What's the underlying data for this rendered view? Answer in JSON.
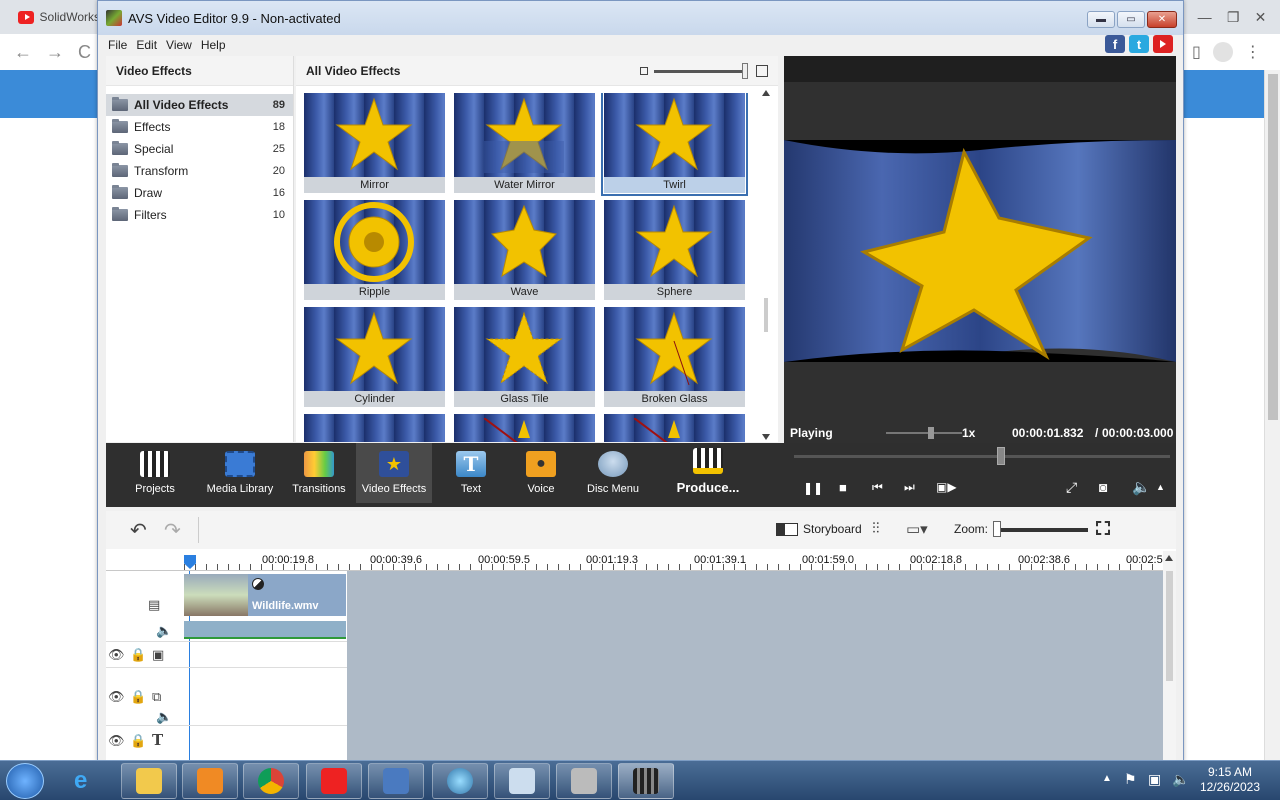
{
  "browser": {
    "tab_title": "SolidWorks"
  },
  "app": {
    "title": "AVS Video Editor 9.9 - Non-activated",
    "menu": [
      "File",
      "Edit",
      "View",
      "Help"
    ],
    "social": {
      "facebook": "f",
      "twitter": "t"
    }
  },
  "categories_panel": {
    "title": "Video Effects",
    "items": [
      {
        "label": "All Video Effects",
        "count": "89",
        "selected": true
      },
      {
        "label": "Effects",
        "count": "18"
      },
      {
        "label": "Special",
        "count": "25"
      },
      {
        "label": "Transform",
        "count": "20"
      },
      {
        "label": "Draw",
        "count": "16"
      },
      {
        "label": "Filters",
        "count": "10"
      }
    ]
  },
  "effects_panel": {
    "title": "All Video Effects",
    "tiles": [
      {
        "label": "Mirror"
      },
      {
        "label": "Water Mirror"
      },
      {
        "label": "Twirl",
        "selected": true
      },
      {
        "label": "Ripple"
      },
      {
        "label": "Wave"
      },
      {
        "label": "Sphere"
      },
      {
        "label": "Cylinder"
      },
      {
        "label": "Glass Tile"
      },
      {
        "label": "Broken Glass"
      }
    ]
  },
  "preview": {
    "status": "Playing",
    "speed": "1x",
    "current_time": "00:00:01.832",
    "separator": "/",
    "total_time": "00:00:03.000",
    "seek_fraction": 0.55
  },
  "modules": [
    {
      "label": "Projects",
      "icon": "clapper-icon"
    },
    {
      "label": "Media Library",
      "icon": "film-icon"
    },
    {
      "label": "Transitions",
      "icon": "transitions-icon"
    },
    {
      "label": "Video Effects",
      "icon": "star-icon",
      "selected": true
    },
    {
      "label": "Text",
      "icon": "text-icon"
    },
    {
      "label": "Voice",
      "icon": "microphone-icon"
    },
    {
      "label": "Disc Menu",
      "icon": "disc-menu-icon"
    },
    {
      "label": "Produce...",
      "icon": "produce-icon"
    }
  ],
  "timeline_toolbar": {
    "storyboard_label": "Storyboard",
    "zoom_label": "Zoom:"
  },
  "ruler": [
    "00:00:19.8",
    "00:00:39.6",
    "00:00:59.5",
    "00:01:19.3",
    "00:01:39.1",
    "00:01:59.0",
    "00:02:18.8",
    "00:02:38.6",
    "00:02:5"
  ],
  "clip": {
    "name": "Wildlife.wmv"
  },
  "taskbar": {
    "time": "9:15 AM",
    "date": "12/26/2023"
  },
  "colors": {
    "accent": "#3a6fb0",
    "star": "#f2c200",
    "timeline_bg": "#aebac7",
    "toolbar_dark": "#2f2f2f"
  }
}
